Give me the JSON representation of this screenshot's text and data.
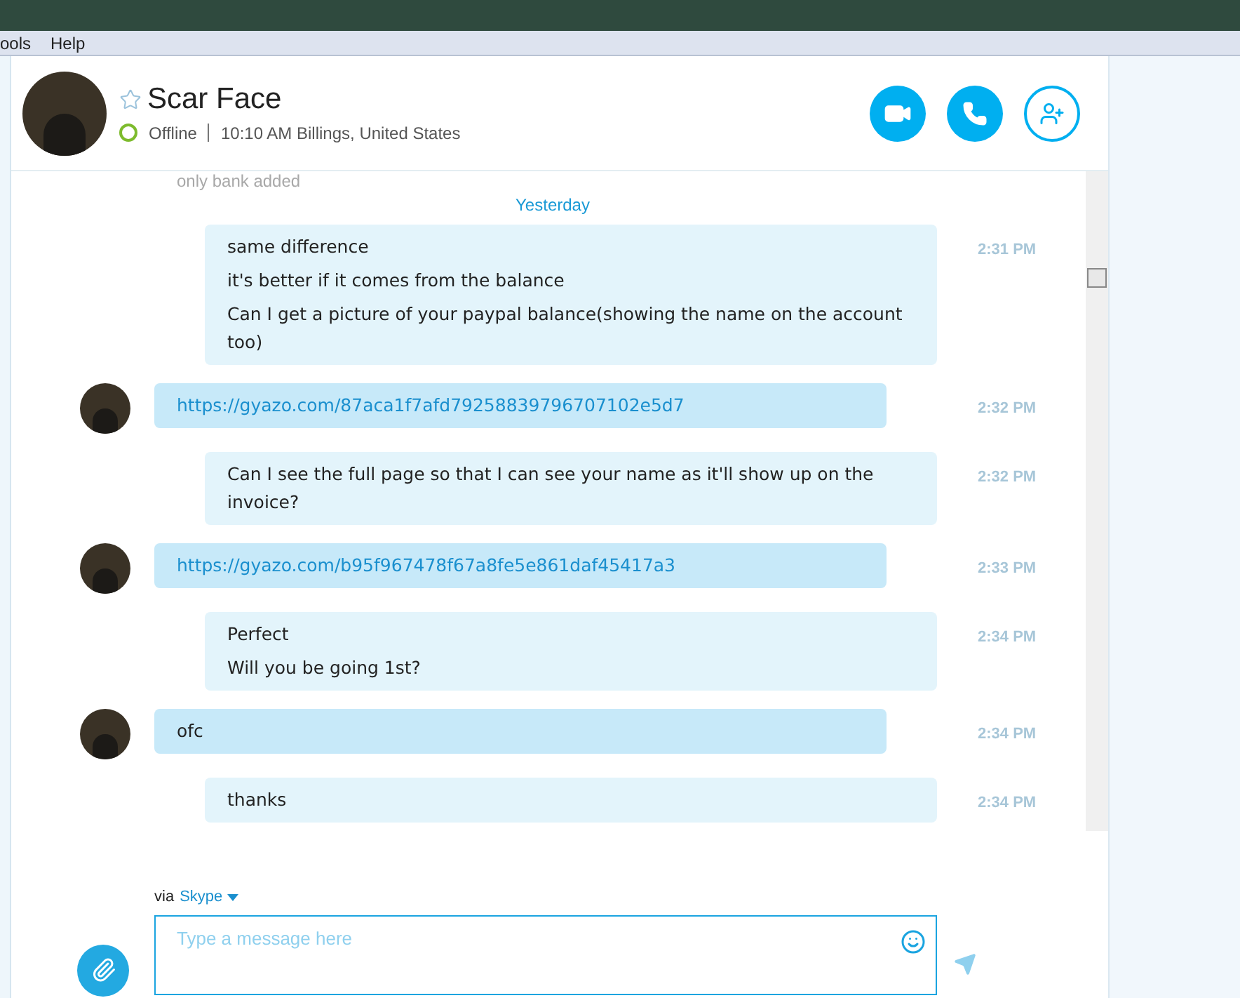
{
  "menu_bar": {
    "items": [
      "ools",
      "Help"
    ]
  },
  "contact": {
    "name": "Scar Face",
    "favorite": false,
    "status": "Offline",
    "details": "10:10 AM Billings, United States"
  },
  "faded_message": "only bank added",
  "date_divider": "Yesterday",
  "messages": [
    {
      "kind": "outgoing",
      "lines": [
        "same difference",
        "it's better if it comes from the balance",
        "Can I get a picture of your paypal balance(showing the name on the account too)"
      ],
      "time": "2:31 PM"
    },
    {
      "kind": "incoming",
      "lines": [
        "https://gyazo.com/87aca1f7afd79258839796707102e5d7"
      ],
      "link": true,
      "time": "2:32 PM"
    },
    {
      "kind": "outgoing",
      "lines": [
        "Can I see the full page so that I can see your name as it'll show up on the invoice?"
      ],
      "time": "2:32 PM"
    },
    {
      "kind": "incoming",
      "lines": [
        "https://gyazo.com/b95f967478f67a8fe5e861daf45417a3"
      ],
      "link": true,
      "time": "2:33 PM"
    },
    {
      "kind": "outgoing",
      "lines": [
        "Perfect",
        "Will you be going 1st?"
      ],
      "time": "2:34 PM"
    },
    {
      "kind": "incoming",
      "lines": [
        "ofc"
      ],
      "link": false,
      "time": "2:34 PM"
    },
    {
      "kind": "outgoing",
      "lines": [
        "thanks"
      ],
      "time": "2:34 PM"
    }
  ],
  "compose": {
    "via_label": "via",
    "via_service": "Skype",
    "placeholder": "Type a message here"
  }
}
